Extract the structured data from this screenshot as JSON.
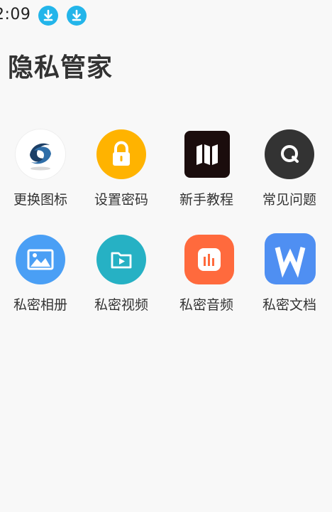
{
  "status_bar": {
    "time": "2:09",
    "icons": [
      "download-icon",
      "download-icon"
    ],
    "icon_color": "#23b5ea"
  },
  "header": {
    "title": "隐私管家"
  },
  "grid": {
    "items": [
      {
        "label": "更换图标",
        "icon": "app-logo-icon",
        "bg": "#ffffff"
      },
      {
        "label": "设置密码",
        "icon": "lock-icon",
        "bg": "#ffb300"
      },
      {
        "label": "新手教程",
        "icon": "map-icon",
        "bg": "#1b0d0d"
      },
      {
        "label": "常见问题",
        "icon": "q-icon",
        "bg": "#333333"
      },
      {
        "label": "私密相册",
        "icon": "photo-icon",
        "bg": "#4a9ff5"
      },
      {
        "label": "私密视频",
        "icon": "video-folder-icon",
        "bg": "#26b1c4"
      },
      {
        "label": "私密音频",
        "icon": "audio-icon",
        "bg": "#ff6a3d"
      },
      {
        "label": "私密文档",
        "icon": "document-w-icon",
        "bg": "#4f8ff2"
      }
    ]
  }
}
